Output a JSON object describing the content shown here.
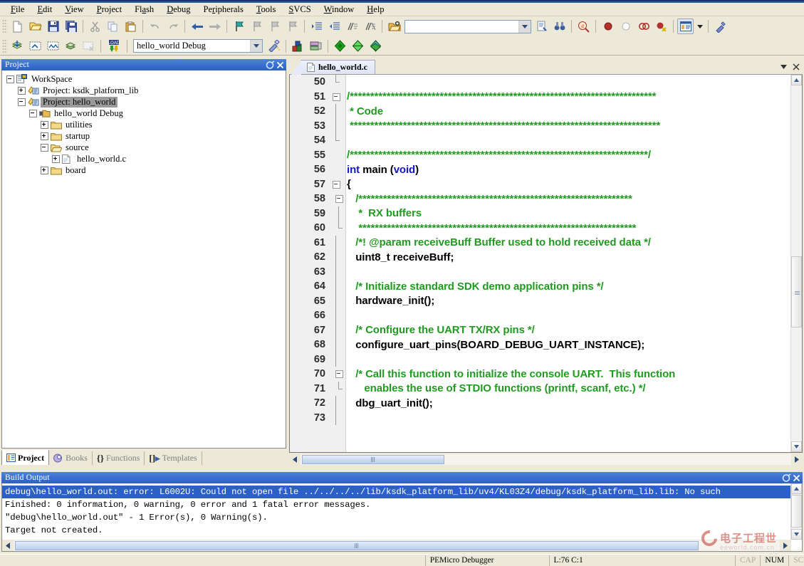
{
  "menu": {
    "items": [
      {
        "label": "File",
        "accel": "F"
      },
      {
        "label": "Edit",
        "accel": "E"
      },
      {
        "label": "View",
        "accel": "V"
      },
      {
        "label": "Project",
        "accel": "P"
      },
      {
        "label": "Flash",
        "accel": "a"
      },
      {
        "label": "Debug",
        "accel": "D"
      },
      {
        "label": "Peripherals",
        "accel": "r"
      },
      {
        "label": "Tools",
        "accel": "T"
      },
      {
        "label": "SVCS",
        "accel": "S"
      },
      {
        "label": "Window",
        "accel": "W"
      },
      {
        "label": "Help",
        "accel": "H"
      }
    ]
  },
  "toolbar_file": {
    "buttons": [
      {
        "name": "new-file-icon",
        "tip": "New"
      },
      {
        "name": "open-file-icon",
        "tip": "Open"
      },
      {
        "name": "save-icon",
        "tip": "Save"
      },
      {
        "name": "save-all-icon",
        "tip": "Save All"
      },
      {
        "name": "cut-icon",
        "tip": "Cut"
      },
      {
        "name": "copy-icon",
        "tip": "Copy"
      },
      {
        "name": "paste-icon",
        "tip": "Paste"
      },
      {
        "name": "undo-icon",
        "tip": "Undo"
      },
      {
        "name": "redo-icon",
        "tip": "Redo"
      },
      {
        "name": "navigate-back-icon",
        "tip": "Back"
      },
      {
        "name": "navigate-forward-icon",
        "tip": "Forward"
      },
      {
        "name": "bookmark-toggle-icon",
        "tip": "Insert/Remove Bookmark"
      },
      {
        "name": "bookmark-prev-icon",
        "tip": "Previous Bookmark"
      },
      {
        "name": "bookmark-next-icon",
        "tip": "Next Bookmark"
      },
      {
        "name": "bookmark-clear-icon",
        "tip": "Clear All Bookmarks"
      },
      {
        "name": "indent-icon",
        "tip": "Indent"
      },
      {
        "name": "outdent-icon",
        "tip": "Outdent"
      },
      {
        "name": "comment-icon",
        "tip": "Comment Selection"
      },
      {
        "name": "uncomment-icon",
        "tip": "Uncomment Selection"
      },
      {
        "name": "open-folder-icon",
        "tip": "Open Project"
      }
    ],
    "find_value": "",
    "find_placeholder": "",
    "after_find": [
      {
        "name": "find-in-files-icon",
        "tip": "Find in Files"
      },
      {
        "name": "find-binoculars-icon",
        "tip": "Find"
      },
      {
        "name": "browse-symbol-icon",
        "tip": "Browse"
      },
      {
        "name": "breakpoint-insert-icon",
        "tip": "Insert/Remove Breakpoint"
      },
      {
        "name": "breakpoint-enable-icon",
        "tip": "Enable/Disable Breakpoint"
      },
      {
        "name": "breakpoint-disable-all-icon",
        "tip": "Disable All Breakpoints"
      },
      {
        "name": "breakpoint-kill-all-icon",
        "tip": "Kill All Breakpoints"
      },
      {
        "name": "project-window-icon",
        "tip": "Project Window"
      },
      {
        "name": "chevron-down-icon",
        "tip": "More"
      },
      {
        "name": "configuration-wizard-icon",
        "tip": "Configure"
      }
    ]
  },
  "toolbar_build": {
    "buttons": [
      {
        "name": "translate-icon",
        "tip": "Translate Current File"
      },
      {
        "name": "build-target-icon",
        "tip": "Build"
      },
      {
        "name": "rebuild-all-icon",
        "tip": "Rebuild All Target Files"
      },
      {
        "name": "batch-build-icon",
        "tip": "Batch Build"
      },
      {
        "name": "stop-build-icon",
        "tip": "Stop Build"
      },
      {
        "name": "download-icon",
        "tip": "Download"
      }
    ],
    "target_value": "hello_world Debug",
    "after": [
      {
        "name": "target-options-icon",
        "tip": "Options for Target"
      },
      {
        "name": "manage-project-items-icon",
        "tip": "Manage Project Items"
      },
      {
        "name": "run-to-main-icon",
        "tip": "Run"
      },
      {
        "name": "pack-installer-icon",
        "tip": "Pack Installer"
      },
      {
        "name": "manage-run-time-env-icon",
        "tip": "Manage Run-Time Environment"
      }
    ]
  },
  "project_panel": {
    "title": "Project",
    "tree": [
      {
        "label": "WorkSpace",
        "depth": 0,
        "expander": "minus",
        "icon": "workspace-icon",
        "selected": false
      },
      {
        "label": "Project: ksdk_platform_lib",
        "depth": 1,
        "expander": "plus",
        "icon": "project-icon",
        "selected": false
      },
      {
        "label": "Project: hello_world",
        "depth": 1,
        "expander": "minus",
        "icon": "project-icon",
        "selected": true
      },
      {
        "label": "hello_world Debug",
        "depth": 2,
        "expander": "minus",
        "icon": "target-icon",
        "selected": false
      },
      {
        "label": "utilities",
        "depth": 3,
        "expander": "plus",
        "icon": "folder-icon",
        "selected": false
      },
      {
        "label": "startup",
        "depth": 3,
        "expander": "plus",
        "icon": "folder-icon",
        "selected": false
      },
      {
        "label": "source",
        "depth": 3,
        "expander": "minus",
        "icon": "folder-open-icon",
        "selected": false
      },
      {
        "label": "hello_world.c",
        "depth": 4,
        "expander": "plus",
        "icon": "c-file-icon",
        "selected": false
      },
      {
        "label": "board",
        "depth": 3,
        "expander": "plus",
        "icon": "folder-icon",
        "selected": false
      }
    ],
    "tabs": [
      {
        "label": "Project",
        "icon": "project-tab-icon",
        "active": true
      },
      {
        "label": "Books",
        "icon": "books-tab-icon",
        "active": false
      },
      {
        "label": "Functions",
        "icon": "functions-tab-icon",
        "active": false
      },
      {
        "label": "Templates",
        "icon": "templates-tab-icon",
        "active": false
      }
    ]
  },
  "editor": {
    "tab_label": "hello_world.c",
    "tab_icon": "c-file-icon",
    "tab_menu_icon": "chevron-down-icon",
    "tab_close_icon": "close-icon",
    "first_line": 50,
    "lines": [
      {
        "n": 50,
        "fold": "end",
        "tokens": []
      },
      {
        "n": 51,
        "fold": "minus",
        "tokens": [
          {
            "t": "/***************************************************************************",
            "c": "cmt"
          }
        ]
      },
      {
        "n": 52,
        "fold": "bar",
        "tokens": [
          {
            "t": " * Code",
            "c": "cmt"
          }
        ]
      },
      {
        "n": 53,
        "fold": "bar",
        "tokens": [
          {
            "t": " ****************************************************************************",
            "c": "cmt"
          }
        ]
      },
      {
        "n": 54,
        "fold": "end",
        "tokens": []
      },
      {
        "n": 55,
        "fold": "",
        "tokens": [
          {
            "t": "/*************************************************************************/",
            "c": "cmt"
          }
        ]
      },
      {
        "n": 56,
        "fold": "",
        "tokens": [
          {
            "t": "int ",
            "c": "kw"
          },
          {
            "t": "main ",
            "c": "id"
          },
          {
            "t": "(",
            "c": "id"
          },
          {
            "t": "void",
            "c": "kw"
          },
          {
            "t": ")",
            "c": "id"
          }
        ]
      },
      {
        "n": 57,
        "fold": "minus",
        "tokens": [
          {
            "t": "{",
            "c": "id"
          }
        ]
      },
      {
        "n": 58,
        "fold": "minus2",
        "tokens": [
          {
            "t": "   /*******************************************************************",
            "c": "cmt"
          }
        ]
      },
      {
        "n": 59,
        "fold": "bar2",
        "tokens": [
          {
            "t": "    *  RX buffers",
            "c": "cmt"
          }
        ]
      },
      {
        "n": 60,
        "fold": "end2",
        "tokens": [
          {
            "t": "    ********************************************************************",
            "c": "cmt"
          }
        ]
      },
      {
        "n": 61,
        "fold": "bar",
        "tokens": [
          {
            "t": "   /*! @param receiveBuff Buffer used to hold received data */",
            "c": "cmt"
          }
        ]
      },
      {
        "n": 62,
        "fold": "bar",
        "tokens": [
          {
            "t": "   uint8_t receiveBuff;",
            "c": "id"
          }
        ]
      },
      {
        "n": 63,
        "fold": "bar",
        "tokens": []
      },
      {
        "n": 64,
        "fold": "bar",
        "tokens": [
          {
            "t": "   /* Initialize standard SDK demo application pins */",
            "c": "cmt"
          }
        ]
      },
      {
        "n": 65,
        "fold": "bar",
        "tokens": [
          {
            "t": "   hardware_init();",
            "c": "id"
          }
        ]
      },
      {
        "n": 66,
        "fold": "bar",
        "tokens": []
      },
      {
        "n": 67,
        "fold": "bar",
        "tokens": [
          {
            "t": "   /* Configure the UART TX/RX pins */",
            "c": "cmt"
          }
        ]
      },
      {
        "n": 68,
        "fold": "bar",
        "tokens": [
          {
            "t": "   configure_uart_pins(BOARD_DEBUG_UART_INSTANCE);",
            "c": "id"
          }
        ]
      },
      {
        "n": 69,
        "fold": "bar",
        "tokens": []
      },
      {
        "n": 70,
        "fold": "minus2",
        "tokens": [
          {
            "t": "   /* Call this function to initialize the console UART.  This function",
            "c": "cmt"
          }
        ]
      },
      {
        "n": 71,
        "fold": "end2",
        "tokens": [
          {
            "t": "      enables the use of STDIO functions (printf, scanf, etc.) */",
            "c": "cmt"
          }
        ]
      },
      {
        "n": 72,
        "fold": "bar",
        "tokens": [
          {
            "t": "   dbg_uart_init();",
            "c": "id"
          }
        ]
      },
      {
        "n": 73,
        "fold": "bar",
        "tokens": []
      }
    ],
    "colors": {
      "comment": "#1f9b1f",
      "keyword": "#1414c8",
      "text": "#000000",
      "gutter_bg": "#f0f0f0"
    }
  },
  "build_output": {
    "title": "Build Output",
    "lines": [
      {
        "text": "debug\\hello_world.out: error: L6002U: Could not open file ../../../../lib/ksdk_platform_lib/uv4/KL03Z4/debug/ksdk_platform_lib.lib: No such",
        "selected": true
      },
      {
        "text": "Finished: 0 information, 0 warning, 0 error and 1 fatal error messages.",
        "selected": false
      },
      {
        "text": "\"debug\\hello_world.out\" - 1 Error(s), 0 Warning(s).",
        "selected": false
      },
      {
        "text": "Target not created.",
        "selected": false
      }
    ]
  },
  "status_bar": {
    "debugger": "PEMicro Debugger",
    "caret": "L:76 C:1",
    "cap": "CAP",
    "num": "NUM",
    "scrl": "SCRL"
  },
  "watermark": {
    "cn": "电子工程世",
    "en": "eeworld.com.cn"
  }
}
